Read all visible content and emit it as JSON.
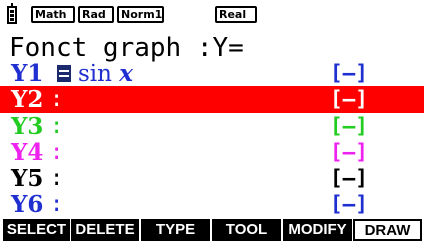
{
  "status": {
    "tags": [
      "Math",
      "Rad",
      "Norm1",
      "Real"
    ]
  },
  "title": "Fonct graph :Y=",
  "functions": [
    {
      "label": "Y1",
      "expr_fn": "sin",
      "expr_var": "x",
      "style": "[—]",
      "color": "#1f2fd0"
    },
    {
      "label": "Y2",
      "colon": ":",
      "style": "[—]",
      "color": "#ffffff"
    },
    {
      "label": "Y3",
      "colon": ":",
      "style": "[—]",
      "color": "#22cc22"
    },
    {
      "label": "Y4",
      "colon": ":",
      "style": "[—]",
      "color": "#ee22ee"
    },
    {
      "label": "Y5",
      "colon": ":",
      "style": "[—]",
      "color": "#000000"
    },
    {
      "label": "Y6",
      "colon": ":",
      "style": "[—]",
      "color": "#1f2fd0"
    }
  ],
  "selected_row": "Y2",
  "fkeys": [
    "SELECT",
    "DELETE",
    "TYPE",
    "TOOL",
    "MODIFY",
    "DRAW"
  ],
  "colors": {
    "highlight": "#ff0000",
    "blue": "#1f2fd0",
    "green": "#22cc22",
    "magenta": "#ee22ee"
  }
}
